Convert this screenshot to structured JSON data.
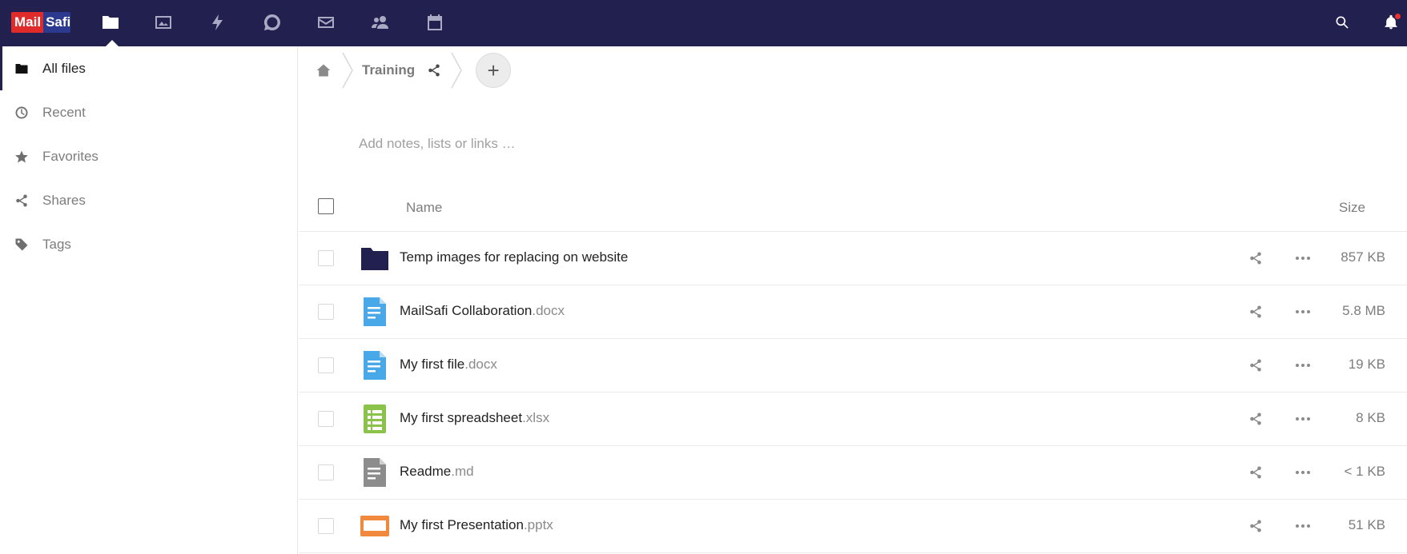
{
  "app": {
    "logo_part1": "Mail",
    "logo_part2": "Safi"
  },
  "topnav": {
    "icons": [
      "files-icon",
      "photos-icon",
      "activity-icon",
      "talk-icon",
      "mail-icon",
      "contacts-icon",
      "calendar-icon"
    ],
    "right_icons": [
      "search-icon",
      "notifications-icon"
    ]
  },
  "sidebar": {
    "items": [
      {
        "label": "All files",
        "icon": "folder-icon",
        "active": true
      },
      {
        "label": "Recent",
        "icon": "clock-icon",
        "active": false
      },
      {
        "label": "Favorites",
        "icon": "star-icon",
        "active": false
      },
      {
        "label": "Shares",
        "icon": "share-icon",
        "active": false
      },
      {
        "label": "Tags",
        "icon": "tag-icon",
        "active": false
      }
    ]
  },
  "breadcrumb": {
    "current": "Training"
  },
  "notes": {
    "placeholder": "Add notes, lists or links …"
  },
  "list": {
    "col_name": "Name",
    "col_size": "Size",
    "files": [
      {
        "name": "Temp images for replacing on website",
        "ext": "",
        "type": "folder",
        "size": "857 KB"
      },
      {
        "name": "MailSafi Collaboration",
        "ext": ".docx",
        "type": "document",
        "size": "5.8 MB"
      },
      {
        "name": "My first file",
        "ext": ".docx",
        "type": "document",
        "size": "19 KB"
      },
      {
        "name": "My first spreadsheet",
        "ext": ".xlsx",
        "type": "spreadsheet",
        "size": "8 KB"
      },
      {
        "name": "Readme",
        "ext": ".md",
        "type": "text",
        "size": "< 1 KB"
      },
      {
        "name": "My first Presentation",
        "ext": ".pptx",
        "type": "presentation",
        "size": "51 KB"
      }
    ]
  },
  "colors": {
    "header_bg": "#22204f",
    "folder": "#22204f",
    "document": "#49a8e8",
    "spreadsheet": "#8bc34a",
    "text": "#8c8c8c",
    "presentation": "#f0883e"
  }
}
